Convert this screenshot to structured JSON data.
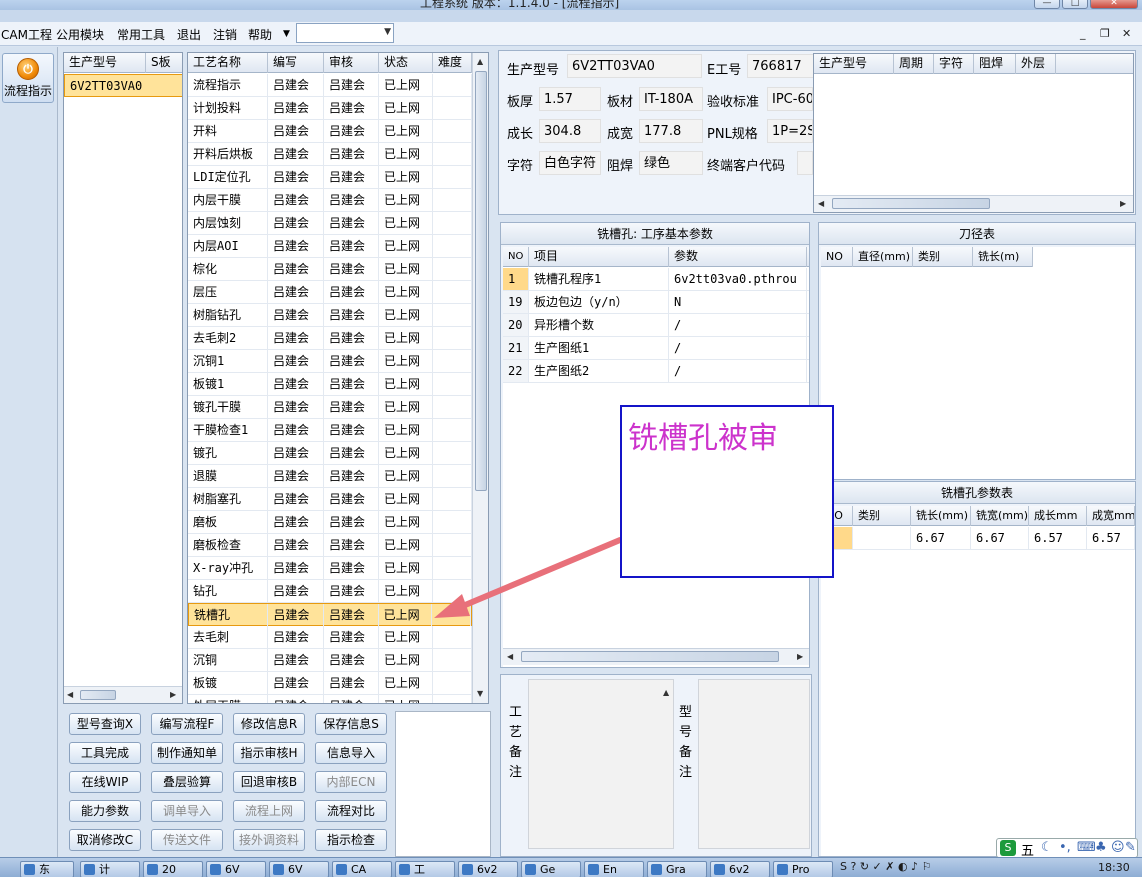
{
  "window": {
    "title": "工程系统  版本：1.1.4.0 - [流程指示]",
    "min": "—",
    "max": "□",
    "close": "✕"
  },
  "menu": [
    "CAM工程",
    "公用模块",
    "常用工具",
    "退出",
    "注销",
    "帮助"
  ],
  "mdi": {
    "min": "_",
    "restore": "❐",
    "close": "✕"
  },
  "nav": {
    "label": "流程指示",
    "icon": "power-icon"
  },
  "prod_grid": {
    "headers": [
      "生产型号",
      "S板"
    ],
    "rows": [
      "6V2TT03VA0"
    ]
  },
  "process_grid": {
    "headers": [
      "工艺名称",
      "编写",
      "审核",
      "状态",
      "难度"
    ],
    "rows": [
      [
        "流程指示",
        "吕建会",
        "吕建会",
        "已上网"
      ],
      [
        "计划投料",
        "吕建会",
        "吕建会",
        "已上网"
      ],
      [
        "开料",
        "吕建会",
        "吕建会",
        "已上网"
      ],
      [
        "开料后烘板",
        "吕建会",
        "吕建会",
        "已上网"
      ],
      [
        "LDI定位孔",
        "吕建会",
        "吕建会",
        "已上网"
      ],
      [
        "内层干膜",
        "吕建会",
        "吕建会",
        "已上网"
      ],
      [
        "内层蚀刻",
        "吕建会",
        "吕建会",
        "已上网"
      ],
      [
        "内层AOI",
        "吕建会",
        "吕建会",
        "已上网"
      ],
      [
        "棕化",
        "吕建会",
        "吕建会",
        "已上网"
      ],
      [
        "层压",
        "吕建会",
        "吕建会",
        "已上网"
      ],
      [
        "树脂钻孔",
        "吕建会",
        "吕建会",
        "已上网"
      ],
      [
        "去毛刺2",
        "吕建会",
        "吕建会",
        "已上网"
      ],
      [
        "沉铜1",
        "吕建会",
        "吕建会",
        "已上网"
      ],
      [
        "板镀1",
        "吕建会",
        "吕建会",
        "已上网"
      ],
      [
        "镀孔干膜",
        "吕建会",
        "吕建会",
        "已上网"
      ],
      [
        "干膜检查1",
        "吕建会",
        "吕建会",
        "已上网"
      ],
      [
        "镀孔",
        "吕建会",
        "吕建会",
        "已上网"
      ],
      [
        "退膜",
        "吕建会",
        "吕建会",
        "已上网"
      ],
      [
        "树脂塞孔",
        "吕建会",
        "吕建会",
        "已上网"
      ],
      [
        "磨板",
        "吕建会",
        "吕建会",
        "已上网"
      ],
      [
        "磨板检查",
        "吕建会",
        "吕建会",
        "已上网"
      ],
      [
        "X-ray冲孔",
        "吕建会",
        "吕建会",
        "已上网"
      ],
      [
        "钻孔",
        "吕建会",
        "吕建会",
        "已上网"
      ],
      [
        "铣槽孔",
        "吕建会",
        "吕建会",
        "已上网"
      ],
      [
        "去毛刺",
        "吕建会",
        "吕建会",
        "已上网"
      ],
      [
        "沉铜",
        "吕建会",
        "吕建会",
        "已上网"
      ],
      [
        "板镀",
        "吕建会",
        "吕建会",
        "已上网"
      ],
      [
        "外层干膜",
        "吕建会",
        "吕建会",
        "已上网"
      ]
    ],
    "selected_index": 23
  },
  "buttons": [
    [
      "型号查询X",
      "编写流程F",
      "修改信息R",
      "保存信息S"
    ],
    [
      "工具完成",
      "制作通知单",
      "指示审核H",
      "信息导入"
    ],
    [
      "在线WIP",
      "叠层验算",
      "回退审核B",
      "内部ECN"
    ],
    [
      "能力参数",
      "调单导入",
      "流程上网",
      "流程对比"
    ],
    [
      "取消修改C",
      "传送文件",
      "接外调资料",
      "指示检查"
    ]
  ],
  "disabled_buttons": [
    "内部ECN",
    "调单导入",
    "流程上网",
    "传送文件",
    "接外调资料"
  ],
  "info": {
    "prod_label": "生产型号",
    "prod_value": "6V2TT03VA0",
    "e_label": "E工号",
    "e_value": "766817",
    "thick_label": "板厚",
    "thick_value": "1.57",
    "material_label": "板材",
    "material_value": "IT-180A",
    "accept_label": "验收标准",
    "accept_value": "IPC-60",
    "len_label": "成长",
    "len_value": "304.8",
    "wid_label": "成宽",
    "wid_value": "177.8",
    "pnl_label": "PNL规格",
    "pnl_value": "1P=2S",
    "char_label": "字符",
    "char_value": "白色字符",
    "mask_label": "阻焊",
    "mask_value": "绿色",
    "cust_label": "终端客户代码",
    "cust_value": ""
  },
  "right_grid": {
    "headers": [
      "生产型号",
      "周期",
      "字符",
      "阻焊",
      "外层"
    ]
  },
  "params": {
    "title": "铣槽孔: 工序基本参数",
    "headers": [
      "NO",
      "项目",
      "参数"
    ],
    "rows": [
      [
        "1",
        "铣槽孔程序1",
        "6v2tt03va0.pthrou"
      ],
      [
        "19",
        "板边包边（y/n）",
        "N"
      ],
      [
        "20",
        "异形槽个数",
        "/"
      ],
      [
        "21",
        "生产图纸1",
        "/"
      ],
      [
        "22",
        "生产图纸2",
        "/"
      ]
    ]
  },
  "tools": {
    "title": "刀径表",
    "headers": [
      "NO",
      "直径(mm)",
      "类别",
      "铣长(m)"
    ]
  },
  "slots": {
    "title": "铣槽孔参数表",
    "headers": [
      "NO",
      "类别",
      "铣长(mm)",
      "铣宽(mm)",
      "成长mm",
      "成宽mm"
    ],
    "rows": [
      [
        "",
        "",
        "6.67",
        "6.67",
        "6.57",
        "6.57"
      ]
    ]
  },
  "notes": {
    "process_label": "工艺备注",
    "model_label": "型号备注"
  },
  "annotation": {
    "text": "铣槽孔被审"
  },
  "taskbar": {
    "start": "东",
    "tasks": [
      "计",
      "20",
      "6V",
      "6V",
      "CA",
      "工",
      "6v2",
      "Ge",
      "En",
      "Gra",
      "6v2",
      "Pro"
    ],
    "clock": "18:30"
  },
  "ime": {
    "text": "五"
  },
  "colors": {
    "selection": "#ffe39a",
    "arrow": "#e8707a",
    "annotation_text": "#cc33cc",
    "annotation_border": "#1414c8"
  }
}
